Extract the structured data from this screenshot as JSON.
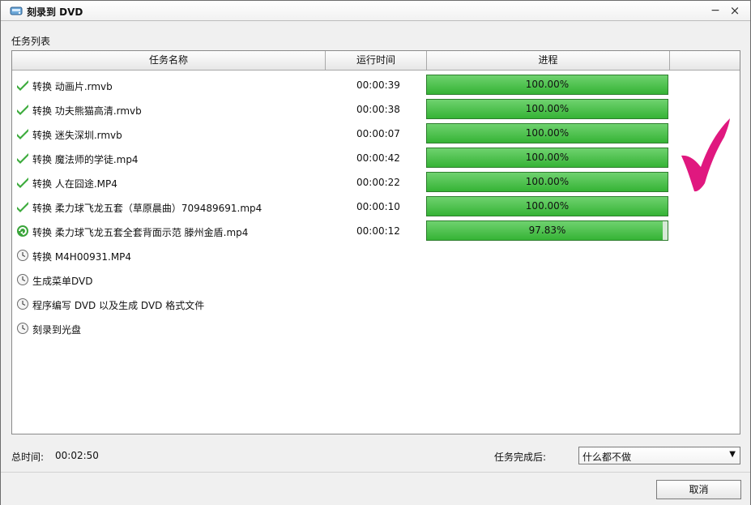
{
  "window": {
    "title": "刻录到 DVD"
  },
  "section": {
    "label": "任务列表"
  },
  "table": {
    "headers": [
      "任务名称",
      "运行时间",
      "进程",
      ""
    ],
    "rows": [
      {
        "name": "转换 动画片.rmvb",
        "time": "00:00:39",
        "progress": "100.00%",
        "status": "done"
      },
      {
        "name": "转换 功夫熊猫高清.rmvb",
        "time": "00:00:38",
        "progress": "100.00%",
        "status": "done"
      },
      {
        "name": "转换 迷失深圳.rmvb",
        "time": "00:00:07",
        "progress": "100.00%",
        "status": "done"
      },
      {
        "name": "转换 魔法师的学徒.mp4",
        "time": "00:00:42",
        "progress": "100.00%",
        "status": "done"
      },
      {
        "name": "转换 人在囧途.MP4",
        "time": "00:00:22",
        "progress": "100.00%",
        "status": "done"
      },
      {
        "name": "转换 柔力球飞龙五套（草原晨曲）709489691.mp4",
        "time": "00:00:10",
        "progress": "100.00%",
        "status": "done"
      },
      {
        "name": "转换 柔力球飞龙五套全套背面示范 滕州金盾.mp4",
        "time": "00:00:12",
        "progress": "97.83%",
        "status": "running"
      },
      {
        "name": "转换 M4H00931.MP4",
        "time": "",
        "progress": "",
        "status": "pending"
      },
      {
        "name": "生成菜单DVD",
        "time": "",
        "progress": "",
        "status": "pending"
      },
      {
        "name": "程序编写 DVD 以及生成 DVD 格式文件",
        "time": "",
        "progress": "",
        "status": "pending"
      },
      {
        "name": "刻录到光盘",
        "time": "",
        "progress": "",
        "status": "pending"
      }
    ]
  },
  "summary": {
    "total_label": "总时间:",
    "total_value": "00:02:50",
    "after_label": "任务完成后:",
    "after_value": "什么都不做"
  },
  "actions": {
    "cancel": "取消"
  },
  "icons": {
    "done": "check-icon",
    "running": "refresh-icon",
    "pending": "clock-icon",
    "big": "large-check-icon"
  },
  "colors": {
    "progress_fill": "#35b335",
    "progress_border": "#2d7d2d",
    "check_mark": "#e0187f"
  }
}
